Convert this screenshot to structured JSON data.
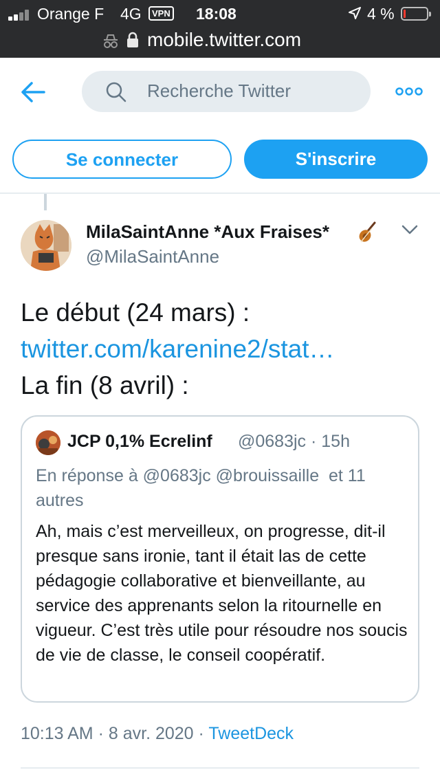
{
  "status_bar": {
    "carrier": "Orange F",
    "network": "4G",
    "vpn": "VPN",
    "time": "18:08",
    "battery": "4 %",
    "battery_level": 0.04
  },
  "browser": {
    "url": "mobile.twitter.com"
  },
  "header": {
    "search_placeholder": "Recherche Twitter",
    "login_label": "Se connecter",
    "signup_label": "S'inscrire"
  },
  "tweet": {
    "display_name": "MilaSaintAnne *Aux Fraises*",
    "handle": "@MilaSaintAnne",
    "body_line1": "Le début (24 mars) :",
    "body_link": "twitter.com/karenine2/stat…",
    "body_line3": "La fin (8 avril) :",
    "time": "10:13 AM",
    "date": "8 avr. 2020",
    "source": "TweetDeck",
    "meta_separator": "·"
  },
  "quoted_tweet": {
    "display_name": "JCP 0,1% Ecrelinf",
    "handle_time": "@0683jc · 15h",
    "reply_prefix": "En réponse à",
    "reply_mentions": "@0683jc @brouissaille",
    "reply_suffix": "et 11 autres",
    "text": "Ah, mais c’est merveilleux, on progresse, dit-il presque sans ironie, tant il était las de cette pédagogie collaborative et bienveillante, au service des apprenants selon la ritournelle en vigueur. C’est très utile pour résoudre nos soucis de vie de classe, le conseil coopératif."
  },
  "colors": {
    "accent": "#1da1f2",
    "link": "#1b95e0",
    "secondary_text": "#657786",
    "border": "#ccd6dd"
  }
}
